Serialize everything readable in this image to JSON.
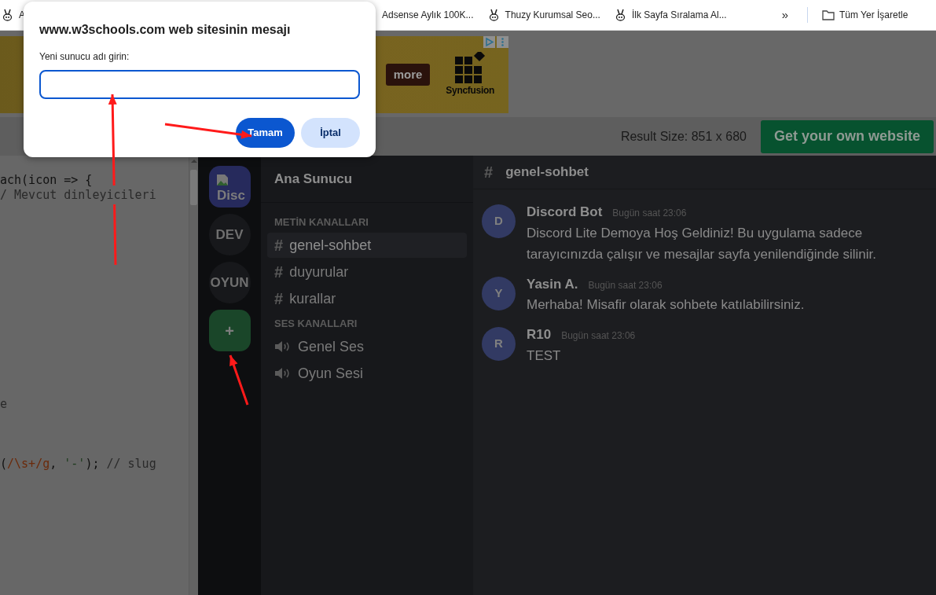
{
  "bookmarks": [
    {
      "label": "A",
      "kind": "site"
    },
    {
      "label": "Adsense Aylık 100K...",
      "kind": "text"
    },
    {
      "label": "Thuzy Kurumsal Seo...",
      "kind": "site"
    },
    {
      "label": "İlk Sayfa Sıralama Al...",
      "kind": "site"
    },
    {
      "label": "»",
      "kind": "more"
    },
    {
      "label": "Tüm Yer İşaretle",
      "kind": "folder"
    }
  ],
  "ad": {
    "button": "more",
    "logo": "Syncfusion"
  },
  "toolbar": {
    "result_size": "Result Size: 851 x 680",
    "cta": "Get your own website"
  },
  "code_lines": [
    {
      "segments": [
        {
          "text": "ach(icon => {",
          "kind": "plain"
        }
      ]
    },
    {
      "segments": [
        {
          "text": "/ Mevcut dinleyicileri",
          "kind": "comment"
        }
      ]
    },
    {
      "segments": [
        {
          "text": "e",
          "kind": "comment"
        }
      ]
    },
    {
      "segments": [
        {
          "text": "(",
          "kind": "plain"
        },
        {
          "text": "/\\s+/g",
          "kind": "regex"
        },
        {
          "text": ", ",
          "kind": "plain"
        },
        {
          "text": "'-'",
          "kind": "string"
        },
        {
          "text": "); ",
          "kind": "plain"
        },
        {
          "text": "// slug",
          "kind": "comment"
        }
      ]
    }
  ],
  "servers": [
    {
      "label": "Disc",
      "kind": "image",
      "selected": true
    },
    {
      "label": "DEV",
      "kind": "text",
      "selected": false
    },
    {
      "label": "OYUN",
      "kind": "text",
      "selected": false
    },
    {
      "label": "+",
      "kind": "add",
      "selected": false
    }
  ],
  "sidebar": {
    "title": "Ana Sunucu",
    "sections": [
      {
        "heading": "METİN KANALLARI",
        "channels": [
          {
            "icon": "#",
            "name": "genel-sohbet",
            "kind": "text",
            "selected": true
          },
          {
            "icon": "#",
            "name": "duyurular",
            "kind": "text",
            "selected": false
          },
          {
            "icon": "#",
            "name": "kurallar",
            "kind": "text",
            "selected": false
          }
        ]
      },
      {
        "heading": "SES KANALLARI",
        "channels": [
          {
            "name": "Genel Ses",
            "kind": "voice",
            "selected": false
          },
          {
            "name": "Oyun Sesi",
            "kind": "voice",
            "selected": false
          }
        ]
      }
    ]
  },
  "chat": {
    "hash": "#",
    "channel": "genel-sohbet",
    "messages": [
      {
        "initial": "D",
        "author": "Discord Bot",
        "time": "Bugün saat 23:06",
        "text": "Discord Lite Demoya Hoş Geldiniz! Bu uygulama sadece tarayıcınızda çalışır ve mesajlar sayfa yenilendiğinde silinir."
      },
      {
        "initial": "Y",
        "author": "Yasin A.",
        "time": "Bugün saat 23:06",
        "text": "Merhaba! Misafir olarak sohbete katılabilirsiniz."
      },
      {
        "initial": "R",
        "author": "R10",
        "time": "Bugün saat 23:06",
        "text": "TEST"
      }
    ]
  },
  "dialog": {
    "title": "www.w3schools.com web sitesinin mesajı",
    "label": "Yeni sunucu adı girin:",
    "buttons": [
      {
        "label": "Tamam",
        "kind": "primary"
      },
      {
        "label": "İptal",
        "kind": "secondary"
      }
    ]
  }
}
